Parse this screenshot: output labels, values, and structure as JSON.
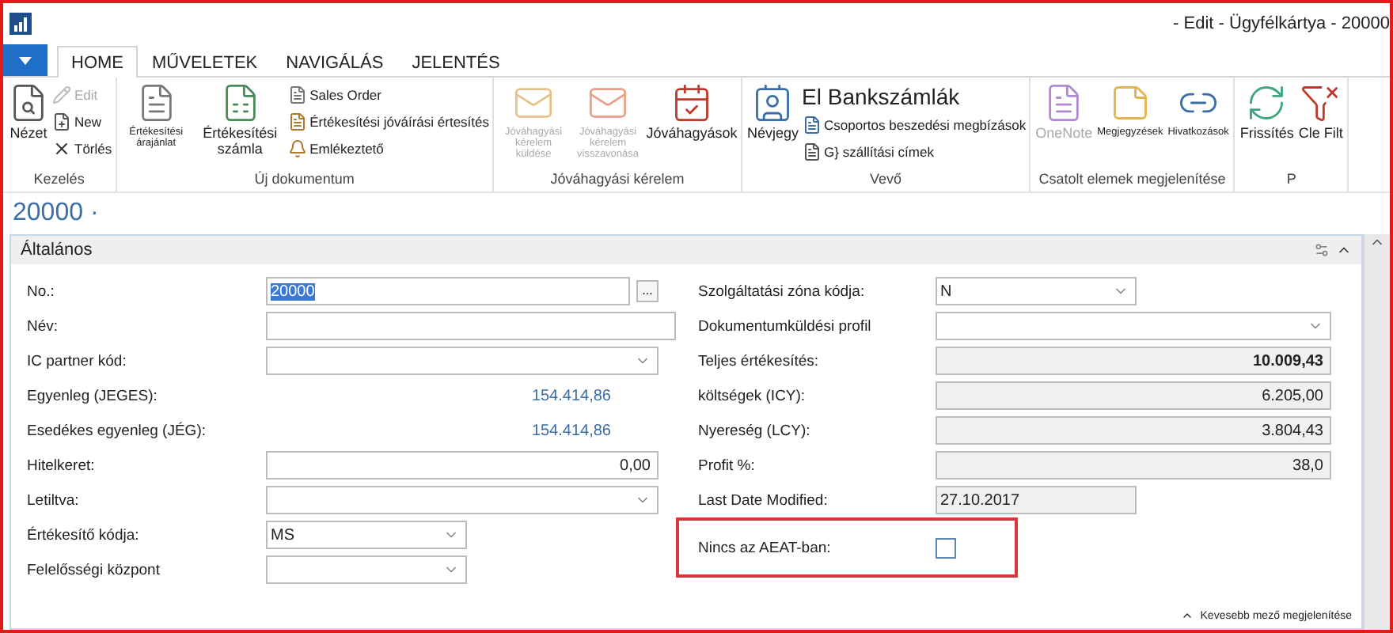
{
  "title_bar": {
    "title": "- Edit - Ügyfélkártya - 20000"
  },
  "tabs": [
    {
      "label": "HOME",
      "selected": true
    },
    {
      "label": "MŰVELETEK",
      "selected": false
    },
    {
      "label": "NAVIGÁLÁS",
      "selected": false
    },
    {
      "label": "JELENTÉS",
      "selected": false
    }
  ],
  "ribbon": {
    "groups": [
      {
        "label": "Kezelés",
        "items": [
          {
            "kind": "large",
            "label": "Nézet",
            "disabled": false
          },
          {
            "kind": "small",
            "label": "Edit",
            "disabled": true
          },
          {
            "kind": "small",
            "label": "New",
            "disabled": false
          },
          {
            "kind": "small",
            "label": "Törlés",
            "disabled": false
          }
        ]
      },
      {
        "label": "Új dokumentum",
        "items": [
          {
            "kind": "tiny",
            "label": "Értékesítési árajánlat",
            "disabled": false
          },
          {
            "kind": "large",
            "label": "Értékesítési számla",
            "disabled": false
          },
          {
            "kind": "small",
            "label": "Sales Order",
            "disabled": false
          },
          {
            "kind": "small",
            "label": "Értékesítési jóváírási értesítés",
            "disabled": false
          },
          {
            "kind": "small",
            "label": "Emlékeztető",
            "disabled": false
          }
        ]
      },
      {
        "label": "Jóváhagyási kérelem",
        "items": [
          {
            "kind": "tiny",
            "label": "Jóváhagyási kérelem küldése",
            "disabled": true
          },
          {
            "kind": "tiny",
            "label": "Jóváhagyási kérelem visszavonása",
            "disabled": true
          },
          {
            "kind": "large",
            "label": "Jóváhagyások",
            "disabled": false
          }
        ]
      },
      {
        "label": "Vevő",
        "items": [
          {
            "kind": "large",
            "label": "Névjegy",
            "disabled": false
          },
          {
            "kind": "headline",
            "label": "El Bankszámlák",
            "disabled": false
          },
          {
            "kind": "small",
            "label": "Csoportos beszedési megbízások",
            "disabled": false
          },
          {
            "kind": "small",
            "label": "G} szállítási címek",
            "disabled": false
          }
        ]
      },
      {
        "label": "Csatolt elemek megjelenítése",
        "items": [
          {
            "kind": "large",
            "label": "OneNote",
            "disabled": true
          },
          {
            "kind": "tiny",
            "label": "Megjegyzések",
            "disabled": false
          },
          {
            "kind": "tiny",
            "label": "Hivatkozások",
            "disabled": false
          }
        ]
      },
      {
        "label": "P",
        "items": [
          {
            "kind": "large",
            "label": "Frissítés",
            "disabled": false
          },
          {
            "kind": "large",
            "label": "Cle Filt",
            "disabled": false
          }
        ]
      }
    ]
  },
  "page_title": "20000 ·",
  "panel": {
    "title": "Általános",
    "footer_link": "Kevesebb mező megjelenítése",
    "left_fields": [
      {
        "kind": "text",
        "label": "No.:",
        "value": "20000",
        "text_selected": true,
        "lookup_button": "..."
      },
      {
        "kind": "text",
        "label": "Név:"
      },
      {
        "kind": "dropdown",
        "label": "IC partner kód:"
      },
      {
        "kind": "amount",
        "label": "Egyenleg (JEGES):",
        "value": "154.414,86"
      },
      {
        "kind": "amount",
        "label": "Esedékes egyenleg (JÉG):",
        "value": "154.414,86"
      },
      {
        "kind": "number",
        "label": "Hitelkeret:",
        "value": "0,00"
      },
      {
        "kind": "dropdown",
        "label": "Letiltva:"
      },
      {
        "kind": "dropdown",
        "label": "Értékesítő kódja:",
        "value": "MS"
      },
      {
        "kind": "dropdown",
        "label": "Felelősségi központ"
      }
    ],
    "right_fields": [
      {
        "kind": "dropdown",
        "label": "Szolgáltatási zóna kódja:",
        "value": "N"
      },
      {
        "kind": "dropdown",
        "label": "Dokumentumküldési profil"
      },
      {
        "kind": "readonly",
        "label": "Teljes értékesítés:",
        "value": "10.009,43",
        "bold": true
      },
      {
        "kind": "readonly",
        "label": "költségek (ICY):",
        "value": "6.205,00",
        "bold": false
      },
      {
        "kind": "readonly",
        "label": "Nyereség (LCY):",
        "value": "3.804,43",
        "bold": false
      },
      {
        "kind": "readonly",
        "label": "Profit %:",
        "value": "38,0",
        "bold": false
      },
      {
        "kind": "readonly-left",
        "label": "Last Date Modified:",
        "value": "27.10.2017"
      },
      {
        "kind": "checkbox",
        "label": "Nincs az AEAT-ban:",
        "checked": false,
        "highlighted": true
      }
    ]
  }
}
